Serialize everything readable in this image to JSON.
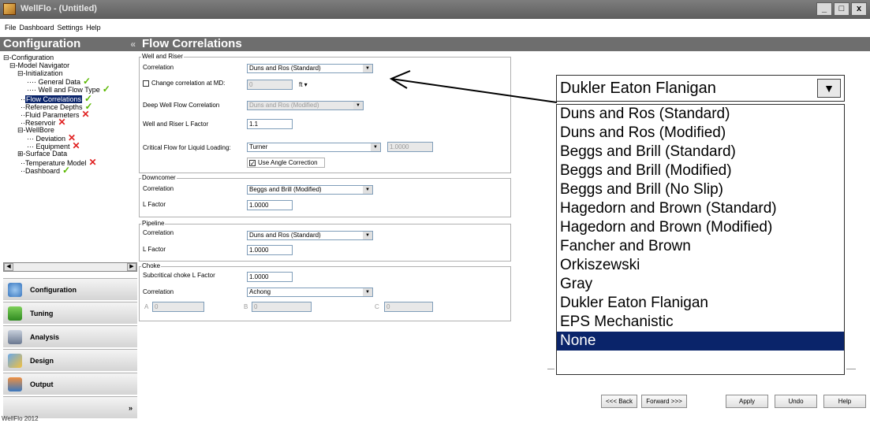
{
  "window": {
    "title": "WellFlo - (Untitled)",
    "buttons": [
      "_",
      "□",
      "x"
    ]
  },
  "menu": [
    "File",
    "Dashboard",
    "Settings",
    "Help"
  ],
  "left_header": {
    "title": "Configuration",
    "collapse": "«"
  },
  "tree": [
    {
      "label": "Configuration",
      "prefix": "⊟-",
      "status": ""
    },
    {
      "label": "Model Navigator",
      "prefix": "⊟-",
      "status": ""
    },
    {
      "label": "Initialization",
      "prefix": "⊟-",
      "status": ""
    },
    {
      "label": "General Data",
      "prefix": "",
      "status": "check"
    },
    {
      "label": "Well and Flow Type",
      "prefix": "",
      "status": "check"
    },
    {
      "label": "Flow Correlations",
      "prefix": "",
      "status": "check"
    },
    {
      "label": "Reference Depths",
      "prefix": "",
      "status": "check"
    },
    {
      "label": "Fluid Parameters",
      "prefix": "",
      "status": "cross"
    },
    {
      "label": "Reservoir",
      "prefix": "",
      "status": "cross"
    },
    {
      "label": "WellBore",
      "prefix": "⊟-",
      "status": ""
    },
    {
      "label": "Deviation",
      "prefix": "",
      "status": "cross"
    },
    {
      "label": "Equipment",
      "prefix": "",
      "status": "cross"
    },
    {
      "label": "Surface Data",
      "prefix": "⊞-",
      "status": ""
    },
    {
      "label": "Temperature Model",
      "prefix": "",
      "status": "cross"
    },
    {
      "label": "Dashboard",
      "prefix": "",
      "status": "check"
    }
  ],
  "nav": {
    "configuration": "Configuration",
    "tuning": "Tuning",
    "analysis": "Analysis",
    "design": "Design",
    "output": "Output",
    "more": "»"
  },
  "status_bar": "WellFlo 2012",
  "main": {
    "title": "Flow Correlations",
    "well_riser": {
      "group": "Well and Riser",
      "correlation_label": "Correlation",
      "correlation_value": "Duns and Ros (Standard)",
      "change_md_label": "Change correlation at MD:",
      "change_md_value": "0",
      "change_md_unit": "ft ▾",
      "deep_label": "Deep Well Flow Correlation",
      "deep_value": "Duns and Ros (Modified)",
      "lfactor_label": "Well and Riser L Factor",
      "lfactor_value": "1.1",
      "critical_label": "Critical Flow for Liquid Loading:",
      "critical_value": "Turner",
      "critical_num": "1.0000",
      "angle_label": "Use Angle Correction"
    },
    "downcomer": {
      "group": "Downcomer",
      "correlation_label": "Correlation",
      "correlation_value": "Beggs and Brill (Modified)",
      "lfactor_label": "L Factor",
      "lfactor_value": "1.0000"
    },
    "pipeline": {
      "group": "Pipeline",
      "correlation_label": "Correlation",
      "correlation_value": "Duns and Ros (Standard)",
      "lfactor_label": "L Factor",
      "lfactor_value": "1.0000"
    },
    "choke": {
      "group": "Choke",
      "subcrit_label": "Subcritical choke L Factor",
      "subcrit_value": "1.0000",
      "correlation_label": "Correlation",
      "correlation_value": "Achong",
      "a_label": "A",
      "a_value": "0",
      "b_label": "B",
      "b_value": "0",
      "c_label": "C",
      "c_value": "0"
    }
  },
  "zoom_dropdown": {
    "selected": "Dukler Eaton Flanigan",
    "options": [
      "Duns and Ros (Standard)",
      "Duns and Ros (Modified)",
      "Beggs and Brill (Standard)",
      "Beggs and Brill (Modified)",
      "Beggs and Brill (No Slip)",
      "Hagedorn and Brown (Standard)",
      "Hagedorn and Brown (Modified)",
      "Fancher and Brown",
      "Orkiszewski",
      "Gray",
      "Dukler Eaton Flanigan",
      "EPS Mechanistic",
      "None"
    ],
    "highlighted_index": 12
  },
  "buttons": {
    "back": "<<< Back",
    "forward": "Forward >>>",
    "apply": "Apply",
    "undo": "Undo",
    "help": "Help"
  },
  "colors": {
    "check": "#5ab800",
    "cross": "#e02020",
    "highlight": "#0a246a",
    "header": "#6e6e6e"
  }
}
